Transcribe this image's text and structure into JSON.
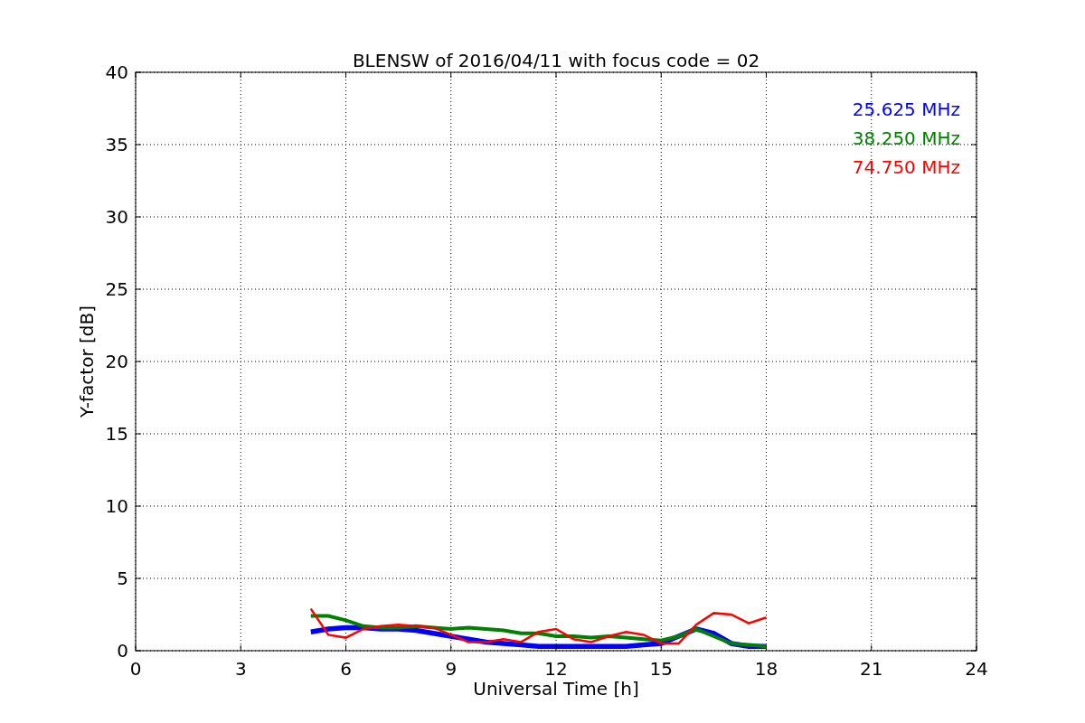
{
  "figure": {
    "chart_data": {
      "type": "line",
      "title": "BLENSW of 2016/04/11 with focus code = 02",
      "xlabel": "Universal Time [h]",
      "ylabel": "Y-factor [dB]",
      "x": [
        5,
        5.5,
        6,
        6.5,
        7,
        7.5,
        8,
        8.5,
        9,
        9.5,
        10,
        10.5,
        11,
        11.5,
        12,
        12.5,
        13,
        13.5,
        14,
        14.5,
        15,
        15.5,
        16,
        16.5,
        17,
        17.5,
        18
      ],
      "grid": true,
      "xlim": [
        0,
        24
      ],
      "ylim": [
        0,
        40
      ],
      "xticks": [
        0,
        3,
        6,
        9,
        12,
        15,
        18,
        21,
        24
      ],
      "yticks": [
        0,
        5,
        10,
        15,
        20,
        25,
        30,
        35,
        40
      ],
      "series": [
        {
          "name": "25.625 MHz",
          "color": "#0000ff",
          "values": [
            1.3,
            1.5,
            1.6,
            1.6,
            1.5,
            1.5,
            1.4,
            1.2,
            1.0,
            0.8,
            0.6,
            0.5,
            0.4,
            0.3,
            0.3,
            0.3,
            0.3,
            0.3,
            0.3,
            0.4,
            0.5,
            1.0,
            1.5,
            1.2,
            0.5,
            0.3,
            0.3
          ]
        },
        {
          "name": "38.250 MHz",
          "color": "#008000",
          "values": [
            2.4,
            2.4,
            2.1,
            1.7,
            1.6,
            1.6,
            1.7,
            1.6,
            1.5,
            1.6,
            1.5,
            1.4,
            1.2,
            1.2,
            1.0,
            1.0,
            0.9,
            1.0,
            0.9,
            0.8,
            0.7,
            1.0,
            1.5,
            1.0,
            0.5,
            0.4,
            0.3
          ]
        },
        {
          "name": "74.750 MHz",
          "color": "#ff0000",
          "values": [
            2.9,
            1.1,
            0.9,
            1.5,
            1.7,
            1.8,
            1.7,
            1.6,
            1.1,
            0.6,
            0.6,
            0.8,
            0.6,
            1.3,
            1.5,
            0.8,
            0.6,
            1.0,
            1.3,
            1.1,
            0.5,
            0.5,
            1.8,
            2.6,
            2.5,
            1.9,
            2.3
          ]
        }
      ]
    }
  }
}
